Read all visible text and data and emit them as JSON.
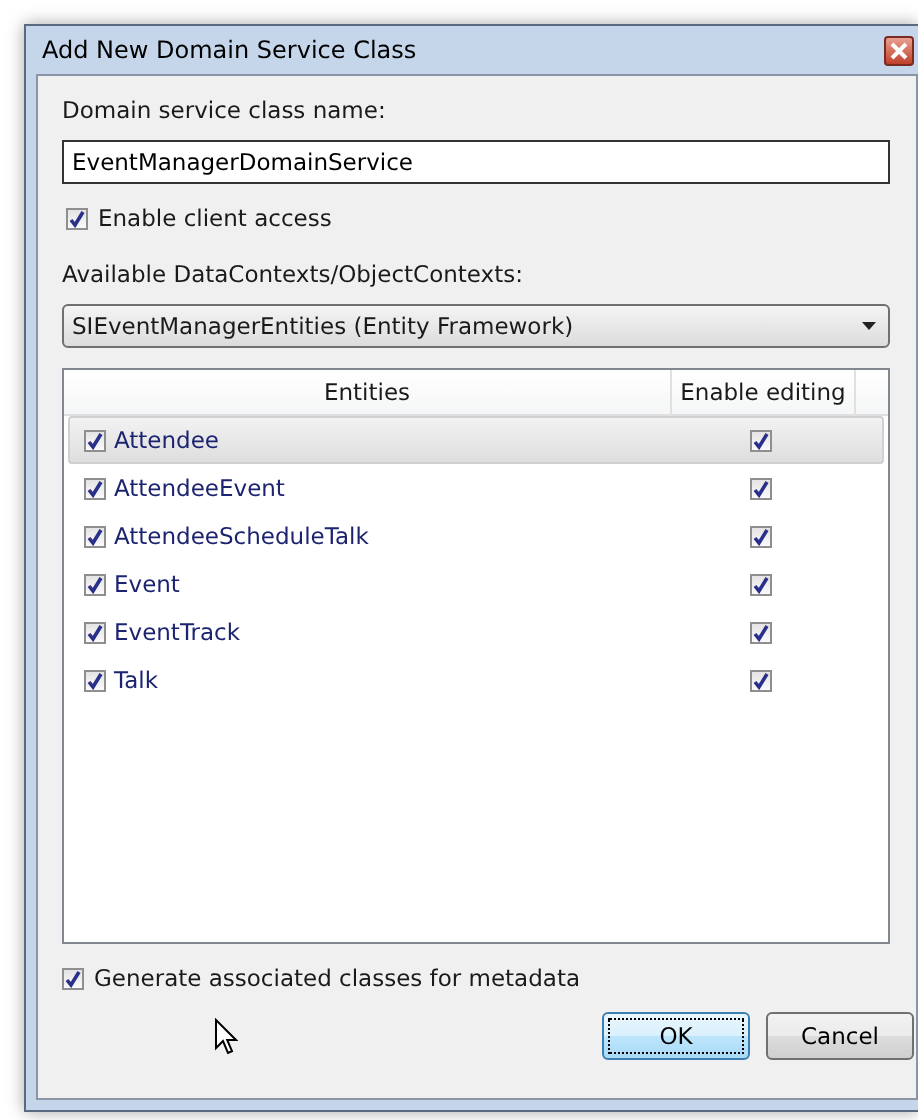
{
  "window": {
    "title": "Add New Domain Service Class"
  },
  "class_name": {
    "label": "Domain service class name:",
    "value": "EventManagerDomainService"
  },
  "enable_client_access": {
    "label": "Enable client access",
    "checked": true
  },
  "contexts": {
    "label": "Available DataContexts/ObjectContexts:",
    "value": "SIEventManagerEntities (Entity Framework)"
  },
  "table": {
    "columns": [
      "Entities",
      "Enable editing"
    ],
    "rows": [
      {
        "name": "Attendee",
        "checked": true,
        "editing": true,
        "selected": true
      },
      {
        "name": "AttendeeEvent",
        "checked": true,
        "editing": true,
        "selected": false
      },
      {
        "name": "AttendeeScheduleTalk",
        "checked": true,
        "editing": true,
        "selected": false
      },
      {
        "name": "Event",
        "checked": true,
        "editing": true,
        "selected": false
      },
      {
        "name": "EventTrack",
        "checked": true,
        "editing": true,
        "selected": false
      },
      {
        "name": "Talk",
        "checked": true,
        "editing": true,
        "selected": false
      }
    ]
  },
  "generate_metadata": {
    "label": "Generate associated classes for metadata",
    "checked": true
  },
  "buttons": [
    {
      "label": "OK",
      "default": true
    },
    {
      "label": "Cancel",
      "default": false
    }
  ]
}
